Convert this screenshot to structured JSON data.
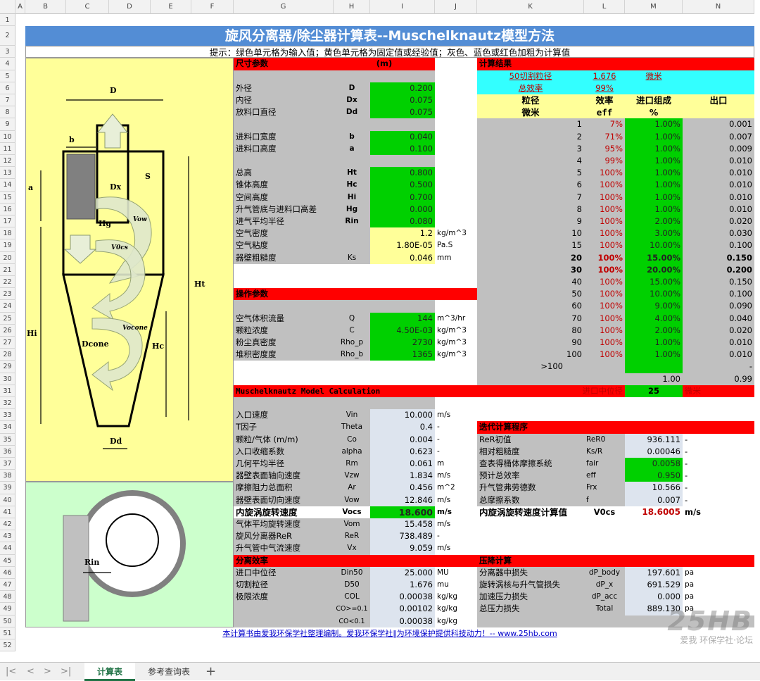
{
  "column_headers": [
    "A",
    "B",
    "C",
    "D",
    "E",
    "F",
    "G",
    "H",
    "I",
    "J",
    "K",
    "L",
    "M",
    "N"
  ],
  "row_headers": [
    "1",
    "2",
    "3",
    "4",
    "5",
    "6",
    "7",
    "8",
    "9",
    "10",
    "11",
    "12",
    "13",
    "14",
    "15",
    "16",
    "17",
    "18",
    "19",
    "20",
    "21",
    "22",
    "23",
    "24",
    "25",
    "26",
    "27",
    "28",
    "29",
    "30",
    "31",
    "32",
    "33",
    "34",
    "35",
    "36",
    "37",
    "38",
    "39",
    "40",
    "41",
    "42",
    "43",
    "44",
    "45",
    "46",
    "47",
    "48",
    "49",
    "50",
    "51",
    "52"
  ],
  "title": "旋风分离器/除尘器计算表--Muschelknautz模型方法",
  "hint": "提示：绿色单元格为输入值；黄色单元格为固定值或经验值；灰色、蓝色或红色加粗为计算值",
  "diagram": {
    "D": "D",
    "b": "b",
    "S": "S",
    "a": "a",
    "Dx": "Dx",
    "Vow": "Vow",
    "Hg": "Hg",
    "V0cs": "V0cs",
    "Ht": "Ht",
    "Hi": "Hi",
    "Vocone": "Vocone",
    "Dcone": "Dcone",
    "Hc": "Hc",
    "Dd": "Dd",
    "Rin": "Rin"
  },
  "dims": {
    "header": "尺寸参数",
    "unit": "(m)",
    "rows": [
      {
        "name": "外径",
        "sym": "D",
        "val": "0.200",
        "unit": ""
      },
      {
        "name": "内径",
        "sym": "Dx",
        "val": "0.075",
        "unit": ""
      },
      {
        "name": "放料口直径",
        "sym": "Dd",
        "val": "0.075",
        "unit": ""
      },
      {
        "name": "进料口宽度",
        "sym": "b",
        "val": "0.040",
        "unit": ""
      },
      {
        "name": "进料口高度",
        "sym": "a",
        "val": "0.100",
        "unit": ""
      },
      {
        "name": "总高",
        "sym": "Ht",
        "val": "0.800",
        "unit": ""
      },
      {
        "name": "锥体高度",
        "sym": "Hc",
        "val": "0.500",
        "unit": ""
      },
      {
        "name": "空间高度",
        "sym": "Hi",
        "val": "0.700",
        "unit": ""
      },
      {
        "name": "升气管底与进料口高差",
        "sym": "Hg",
        "val": "0.000",
        "unit": ""
      },
      {
        "name": "进气平均半径",
        "sym": "Rin",
        "val": "0.080",
        "unit": ""
      },
      {
        "name": "空气密度",
        "sym": "",
        "val": "1.2",
        "unit": "kg/m^3"
      },
      {
        "name": "空气粘度",
        "sym": "",
        "val": "1.80E-05",
        "unit": "Pa.S"
      },
      {
        "name": "器壁粗糙度",
        "sym": "Ks",
        "val": "0.046",
        "unit": "mm"
      }
    ]
  },
  "ops": {
    "header": "操作参数",
    "rows": [
      {
        "name": "空气体积流量",
        "sym": "Q",
        "val": "144",
        "unit": "m^3/hr"
      },
      {
        "name": "颗粒浓度",
        "sym": "C",
        "val": "4.50E-03",
        "unit": "kg/m^3"
      },
      {
        "name": "粉尘真密度",
        "sym": "Rho_p",
        "val": "2730",
        "unit": "kg/m^3"
      },
      {
        "name": "堆积密度度",
        "sym": "Rho_b",
        "val": "1365",
        "unit": "kg/m^3"
      }
    ]
  },
  "model": {
    "header": "Muschelknautz Model Calculation",
    "rows": [
      {
        "name": "入口速度",
        "sym": "Vin",
        "val": "10.000",
        "unit": "m/s"
      },
      {
        "name": "T因子",
        "sym": "Theta",
        "val": "0.4",
        "unit": "-"
      },
      {
        "name": "颗粒/气体 (m/m)",
        "sym": "Co",
        "val": "0.004",
        "unit": "-"
      },
      {
        "name": "入口收缩系数",
        "sym": "alpha",
        "val": "0.623",
        "unit": "-"
      },
      {
        "name": "几何平均半径",
        "sym": "Rm",
        "val": "0.061",
        "unit": "m"
      },
      {
        "name": "器壁表面轴向速度",
        "sym": "Vzw",
        "val": "1.834",
        "unit": "m/s"
      },
      {
        "name": "摩擦阻力总面积",
        "sym": "Ar",
        "val": "0.456",
        "unit": "m^2"
      },
      {
        "name": "器壁表面切向速度",
        "sym": "Vow",
        "val": "12.846",
        "unit": "m/s"
      },
      {
        "name": "内旋涡旋转速度",
        "sym": "Vocs",
        "val": "18.600",
        "unit": "m/s"
      },
      {
        "name": "气体平均旋转速度",
        "sym": "Vom",
        "val": "15.458",
        "unit": "m/s"
      },
      {
        "name": "旋风分离器ReR",
        "sym": "ReR",
        "val": "738.489",
        "unit": "-"
      },
      {
        "name": "升气管中气流速度",
        "sym": "Vx",
        "val": "9.059",
        "unit": "m/s"
      }
    ]
  },
  "sep": {
    "header": "分离效率",
    "rows": [
      {
        "name": "进口中位径",
        "sym": "Din50",
        "val": "25.000",
        "unit": "MU"
      },
      {
        "name": "切割粒径",
        "sym": "D50",
        "val": "1.676",
        "unit": "mu"
      },
      {
        "name": "极限浓度",
        "sym": "COL",
        "val": "0.00038",
        "unit": "kg/kg"
      },
      {
        "name": "",
        "sym": "CO>=0.1",
        "val": "0.00102",
        "unit": "kg/kg"
      },
      {
        "name": "",
        "sym": "CO<0.1",
        "val": "0.00038",
        "unit": "kg/kg"
      }
    ]
  },
  "results": {
    "header": "计算结果",
    "cut_label": "50切割粒径",
    "cut_val": "1.676",
    "cut_unit": "微米",
    "eff_label": "总效率",
    "eff_val": "99%",
    "col_size": "粒径",
    "col_eff": "效率",
    "col_in": "进口组成",
    "col_out": "出口",
    "unit_size": "微米",
    "unit_eff": "eff",
    "unit_in": "%",
    "rows": [
      {
        "size": "1",
        "eff": "7%",
        "inp": "1.00%",
        "out": "0.001"
      },
      {
        "size": "2",
        "eff": "71%",
        "inp": "1.00%",
        "out": "0.007"
      },
      {
        "size": "3",
        "eff": "95%",
        "inp": "1.00%",
        "out": "0.009"
      },
      {
        "size": "4",
        "eff": "99%",
        "inp": "1.00%",
        "out": "0.010"
      },
      {
        "size": "5",
        "eff": "100%",
        "inp": "1.00%",
        "out": "0.010"
      },
      {
        "size": "6",
        "eff": "100%",
        "inp": "1.00%",
        "out": "0.010"
      },
      {
        "size": "7",
        "eff": "100%",
        "inp": "1.00%",
        "out": "0.010"
      },
      {
        "size": "8",
        "eff": "100%",
        "inp": "1.00%",
        "out": "0.010"
      },
      {
        "size": "9",
        "eff": "100%",
        "inp": "2.00%",
        "out": "0.020"
      },
      {
        "size": "10",
        "eff": "100%",
        "inp": "3.00%",
        "out": "0.030"
      },
      {
        "size": "15",
        "eff": "100%",
        "inp": "10.00%",
        "out": "0.100"
      },
      {
        "size": "20",
        "eff": "100%",
        "inp": "15.00%",
        "out": "0.150"
      },
      {
        "size": "30",
        "eff": "100%",
        "inp": "20.00%",
        "out": "0.200"
      },
      {
        "size": "40",
        "eff": "100%",
        "inp": "15.00%",
        "out": "0.150"
      },
      {
        "size": "50",
        "eff": "100%",
        "inp": "10.00%",
        "out": "0.100"
      },
      {
        "size": "60",
        "eff": "100%",
        "inp": "9.00%",
        "out": "0.090"
      },
      {
        "size": "70",
        "eff": "100%",
        "inp": "4.00%",
        "out": "0.040"
      },
      {
        "size": "80",
        "eff": "100%",
        "inp": "2.00%",
        "out": "0.020"
      },
      {
        "size": "90",
        "eff": "100%",
        "inp": "1.00%",
        "out": "0.010"
      },
      {
        "size": "100",
        "eff": "100%",
        "inp": "1.00%",
        "out": "0.010"
      },
      {
        "size": ">100",
        "eff": "",
        "inp": "",
        "out": "-"
      }
    ],
    "total_in": "1.00",
    "total_out": "0.99",
    "med_label": "进口中位径",
    "med_val": "25",
    "med_unit": "微米"
  },
  "iter": {
    "header": "迭代计算程序",
    "rows": [
      {
        "name": "ReR初值",
        "sym": "ReR0",
        "val": "936.111",
        "unit": "-"
      },
      {
        "name": "相对粗糙度",
        "sym": "Ks/R",
        "val": "0.00046",
        "unit": "-"
      },
      {
        "name": "查表得桶体摩擦系统",
        "sym": "fair",
        "val": "0.0058",
        "unit": "-"
      },
      {
        "name": "预计总效率",
        "sym": "eff",
        "val": "0.950",
        "unit": "-"
      },
      {
        "name": "升气管弗劳德数",
        "sym": "Frx",
        "val": "10.566",
        "unit": "-"
      },
      {
        "name": "总摩擦系数",
        "sym": "f",
        "val": "0.007",
        "unit": "-"
      }
    ],
    "vocs_label": "内旋涡旋转速度计算值",
    "vocs_sym": "V0cs",
    "vocs_val": "18.6005",
    "vocs_unit": "m/s"
  },
  "pressure": {
    "header": "压降计算",
    "rows": [
      {
        "name": "分离器中损失",
        "sym": "dP_body",
        "val": "197.601",
        "unit": "pa"
      },
      {
        "name": "旋转涡核与升气管损失",
        "sym": "dP_x",
        "val": "691.529",
        "unit": "pa"
      },
      {
        "name": "加速压力损失",
        "sym": "dP_acc",
        "val": "0.000",
        "unit": "pa"
      },
      {
        "name": "总压力损失",
        "sym": "Total",
        "val": "889.130",
        "unit": "pa"
      }
    ]
  },
  "footer": "本计算书由爱我环保学社整理编制。爱我环保学社‖为环境保护提供科技动力！-- www.25hb.com",
  "watermark": {
    "logo": "25HB",
    "tagline": "爱我 环保学社·论坛"
  },
  "tabs": [
    "计算表",
    "参考查询表"
  ],
  "colors": {
    "green": "#00d000",
    "yellow": "#ffff99",
    "red": "#ff0000",
    "cyan": "#33ffff",
    "gray": "#c0c0c0",
    "blue_title": "#538dd5"
  }
}
